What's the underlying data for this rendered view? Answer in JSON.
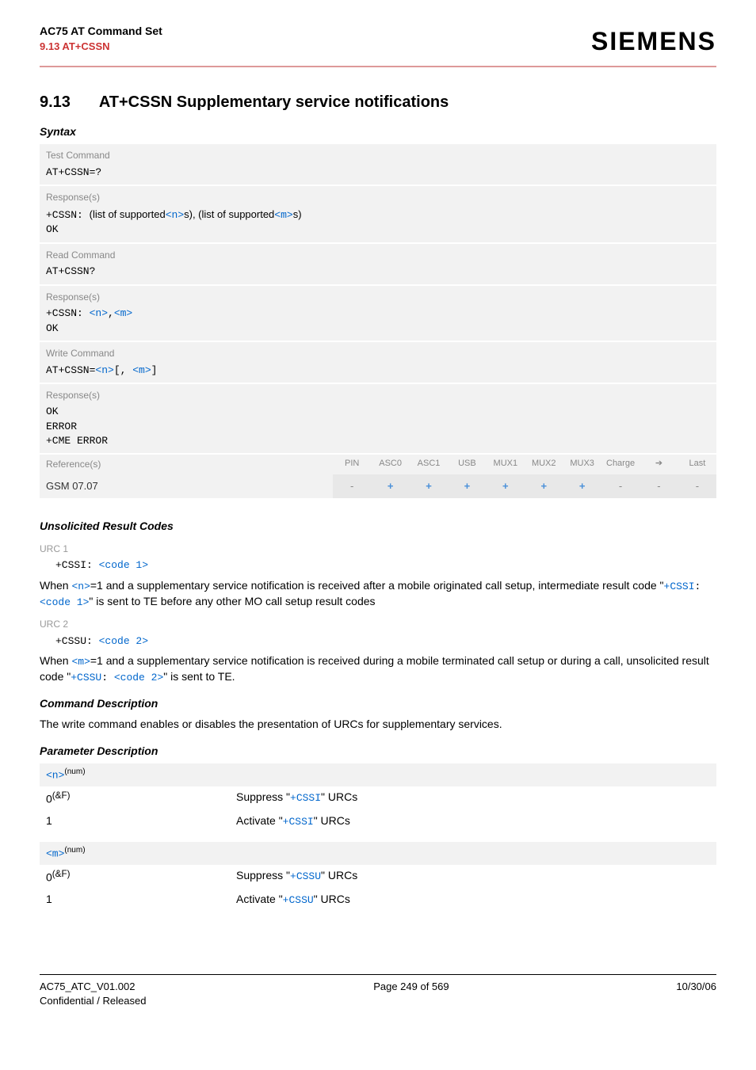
{
  "header": {
    "title": "AC75 AT Command Set",
    "sub": "9.13 AT+CSSN",
    "brand": "SIEMENS"
  },
  "section": {
    "num": "9.13",
    "title": "AT+CSSN   Supplementary service notifications"
  },
  "syntax": {
    "label": "Syntax",
    "test": {
      "label": "Test Command",
      "cmd": "AT+CSSN=?",
      "resp_label": "Response(s)",
      "resp_prefix": "+CSSN: ",
      "resp_mid1": "(list of supported",
      "resp_link1": "<n>",
      "resp_mid2": "s), (list of supported",
      "resp_link2": "<m>",
      "resp_mid3": "s)",
      "ok": "OK"
    },
    "read": {
      "label": "Read Command",
      "cmd": "AT+CSSN?",
      "resp_label": "Response(s)",
      "resp_prefix": "+CSSN: ",
      "n": "<n>",
      "comma": ",",
      "m": "<m>",
      "ok": "OK"
    },
    "write": {
      "label": "Write Command",
      "cmd_prefix": "AT+CSSN=",
      "n": "<n>",
      "bracket_open": "[, ",
      "m": "<m>",
      "bracket_close": "]",
      "resp_label": "Response(s)",
      "ok": "OK",
      "err": "ERROR",
      "cme": "+CME ERROR"
    }
  },
  "ref": {
    "label": "Reference(s)",
    "value": "GSM 07.07",
    "cols": [
      "PIN",
      "ASC0",
      "ASC1",
      "USB",
      "MUX1",
      "MUX2",
      "MUX3",
      "Charge",
      "➔",
      "Last"
    ],
    "vals": [
      "-",
      "+",
      "+",
      "+",
      "+",
      "+",
      "+",
      "-",
      "-",
      "-"
    ]
  },
  "urc": {
    "heading": "Unsolicited Result Codes",
    "u1": {
      "label": "URC 1",
      "code_prefix": "+CSSI: ",
      "code_link": "<code 1>",
      "body1": "When ",
      "link_n": "<n>",
      "body2": "=1 and a supplementary service notification is received after a mobile originated call setup, intermediate result code \"",
      "link_cssi": "+CSSI",
      "body3": ": ",
      "link_code1": "<code 1>",
      "body4": "\" is sent to TE before any other MO call setup result codes"
    },
    "u2": {
      "label": "URC 2",
      "code_prefix": "+CSSU: ",
      "code_link": "<code 2>",
      "body1": "When ",
      "link_m": "<m>",
      "body2": "=1 and a supplementary service notification is received during a mobile terminated call setup or during a call, unsolicited result code \"",
      "link_cssu": "+CSSU",
      "body3": ": ",
      "link_code2": "<code 2>",
      "body4": "\" is sent to TE."
    }
  },
  "cmd_desc": {
    "heading": "Command Description",
    "body": "The write command enables or disables the presentation of URCs for supplementary services."
  },
  "param_desc": {
    "heading": "Parameter Description",
    "n": {
      "head": "<n>",
      "sup": "(num)",
      "r0k": "0",
      "r0ksup": "(&F)",
      "r0v_pre": "Suppress \"",
      "r0v_link": "+CSSI",
      "r0v_post": "\" URCs",
      "r1k": "1",
      "r1v_pre": "Activate \"",
      "r1v_link": "+CSSI",
      "r1v_post": "\" URCs"
    },
    "m": {
      "head": "<m>",
      "sup": "(num)",
      "r0k": "0",
      "r0ksup": "(&F)",
      "r0v_pre": "Suppress \"",
      "r0v_link": "+CSSU",
      "r0v_post": "\" URCs",
      "r1k": "1",
      "r1v_pre": "Activate \"",
      "r1v_link": "+CSSU",
      "r1v_post": "\" URCs"
    }
  },
  "footer": {
    "left1": "AC75_ATC_V01.002",
    "left2": "Confidential / Released",
    "center": "Page 249 of 569",
    "right": "10/30/06"
  }
}
